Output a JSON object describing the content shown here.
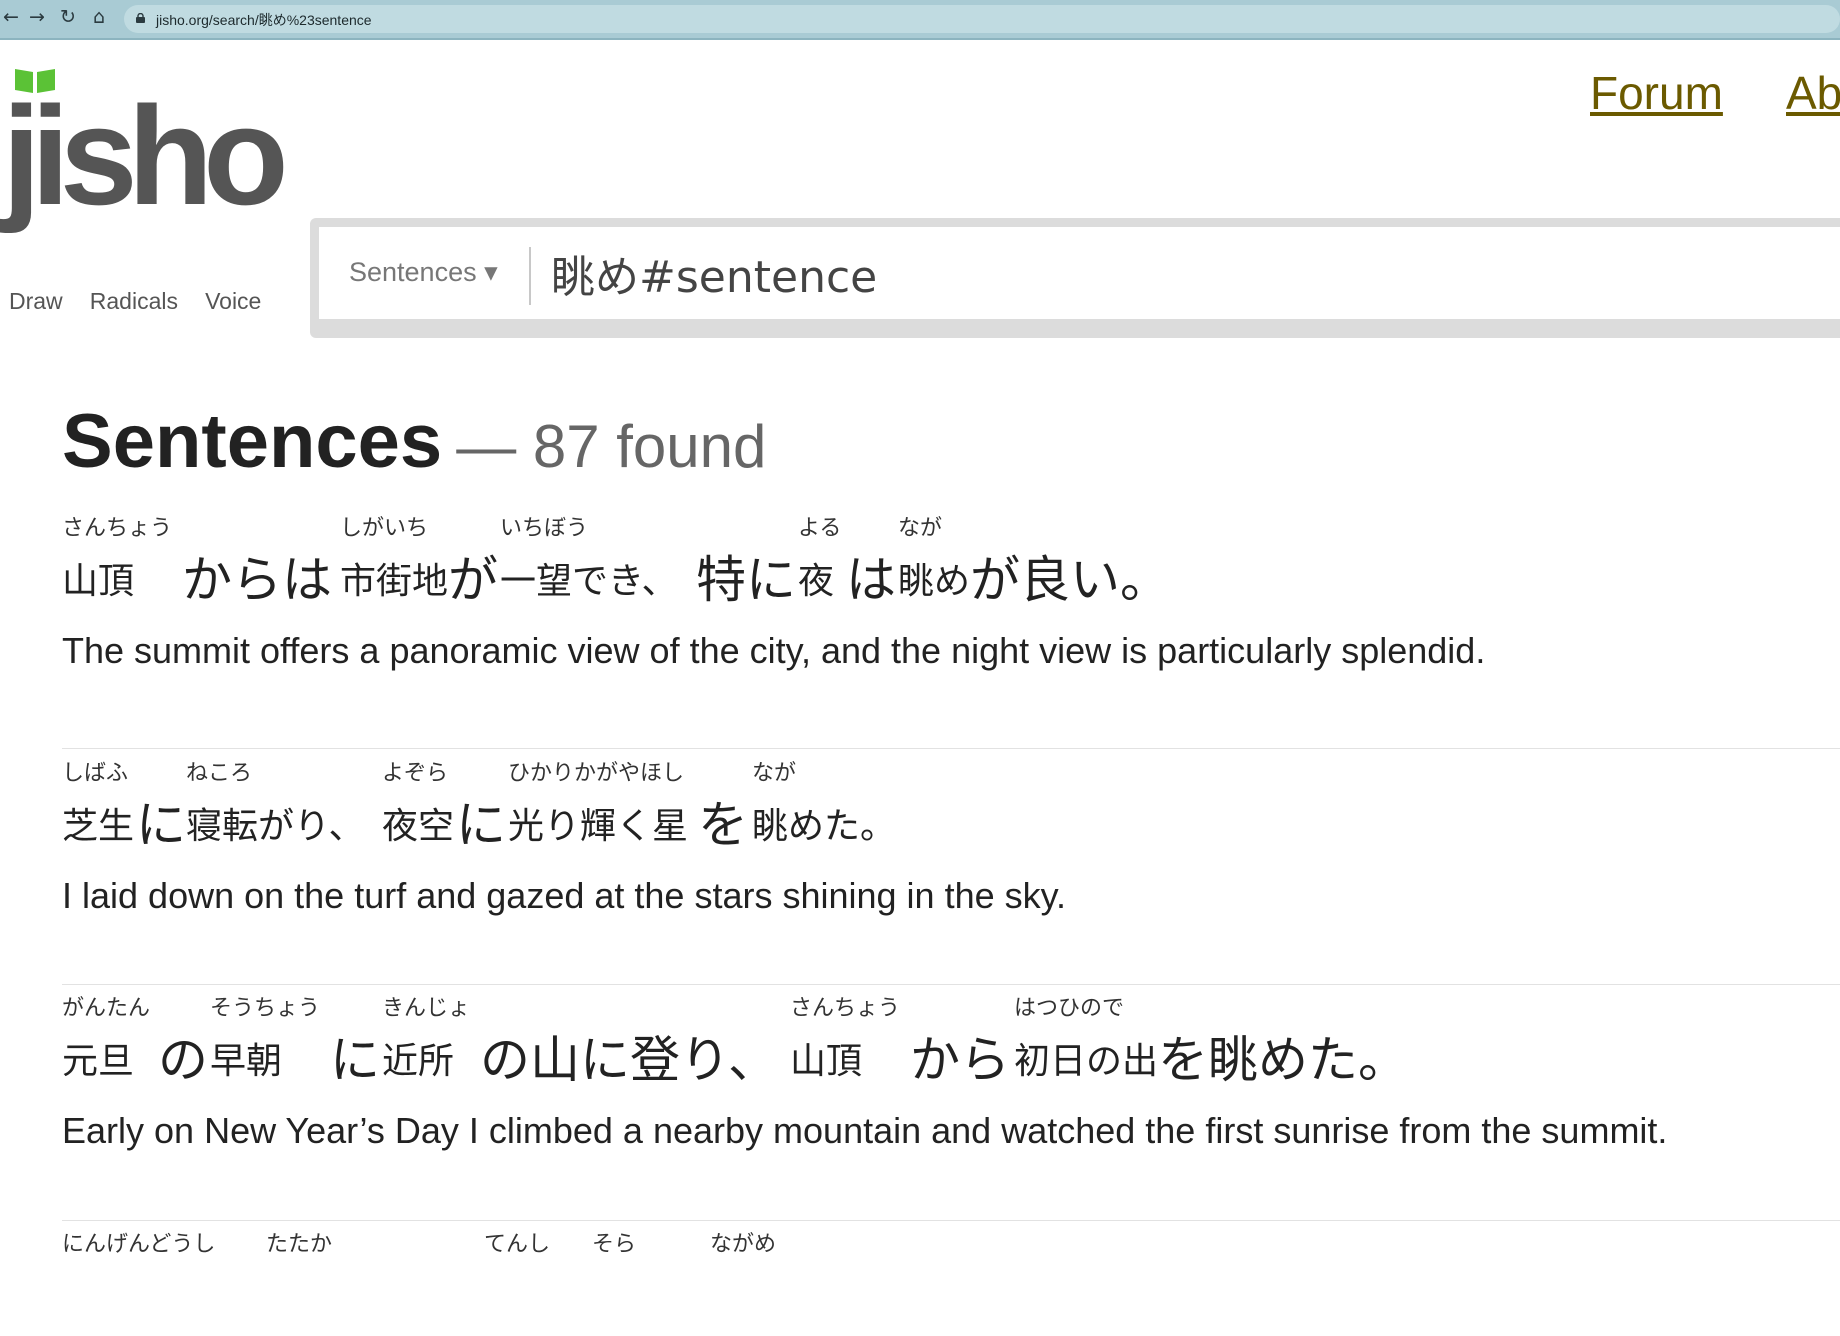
{
  "browser": {
    "url": "jisho.org/search/眺め%23sentence"
  },
  "site": {
    "logo_text": "jisho",
    "nav": [
      "Forum",
      "Ab"
    ]
  },
  "input_tools": [
    "Draw",
    "Radicals",
    "Voice"
  ],
  "search": {
    "type_label": "Sentences ▾",
    "query": "眺め#sentence"
  },
  "results": {
    "heading": "Sentences",
    "count_text": "— 87 found"
  },
  "sentences": [
    {
      "tokens": [
        {
          "furi": "さんちょう",
          "text": "山頂",
          "big": false
        },
        {
          "furi": "",
          "text": "からは",
          "big": true
        },
        {
          "furi": "しがいち",
          "text": "市街地",
          "big": false
        },
        {
          "furi": "",
          "text": "が",
          "big": true
        },
        {
          "furi": "いちぼう",
          "text": "一望",
          "big": false
        },
        {
          "furi": "",
          "text": "でき、",
          "big": false
        },
        {
          "furi": "",
          "text": "特に",
          "big": true
        },
        {
          "furi": "よる",
          "text": "夜",
          "big": false
        },
        {
          "furi": "",
          "text": "は",
          "big": true
        },
        {
          "furi": "なが",
          "text": "眺め",
          "big": false
        },
        {
          "furi": "",
          "text": "が良い。",
          "big": true
        }
      ],
      "english": "The summit offers a panoramic view of the city, and the night view is particularly splendid."
    },
    {
      "tokens": [
        {
          "furi": "しばふ",
          "text": "芝生",
          "big": false
        },
        {
          "furi": "",
          "text": "に",
          "big": true
        },
        {
          "furi": "ねころ",
          "text": "寝転がり、",
          "big": false
        },
        {
          "furi": "よぞら",
          "text": "夜空",
          "big": false
        },
        {
          "furi": "",
          "text": "に",
          "big": true
        },
        {
          "furi": "ひかりかがやほし",
          "text": "光り輝く星",
          "big": false
        },
        {
          "furi": "",
          "text": "を",
          "big": true
        },
        {
          "furi": "なが",
          "text": "眺めた。",
          "big": false
        }
      ],
      "english": "I laid down on the turf and gazed at the stars shining in the sky."
    },
    {
      "tokens": [
        {
          "furi": "がんたん",
          "text": "元旦",
          "big": false
        },
        {
          "furi": "",
          "text": "の",
          "big": true
        },
        {
          "furi": "そうちょう",
          "text": "早朝",
          "big": false
        },
        {
          "furi": "",
          "text": "に",
          "big": true
        },
        {
          "furi": "きんじょ",
          "text": "近所",
          "big": false
        },
        {
          "furi": "",
          "text": "の山に登り、",
          "big": true
        },
        {
          "furi": "さんちょう",
          "text": "山頂",
          "big": false
        },
        {
          "furi": "",
          "text": "から",
          "big": true
        },
        {
          "furi": "はつひので",
          "text": "初日の出",
          "big": false
        },
        {
          "furi": "",
          "text": "を眺めた。",
          "big": true
        }
      ],
      "english": "Early on New Year’s Day I climbed a nearby mountain and watched the first sunrise from the summit."
    },
    {
      "tokens": [
        {
          "furi": "にんげんどうし",
          "text": "",
          "big": false
        },
        {
          "furi": "たたか",
          "text": "",
          "big": false
        },
        {
          "furi": "てんし",
          "text": "",
          "big": false
        },
        {
          "furi": "そら",
          "text": "",
          "big": false
        },
        {
          "furi": "ながめ",
          "text": "",
          "big": false
        }
      ],
      "english": ""
    }
  ]
}
